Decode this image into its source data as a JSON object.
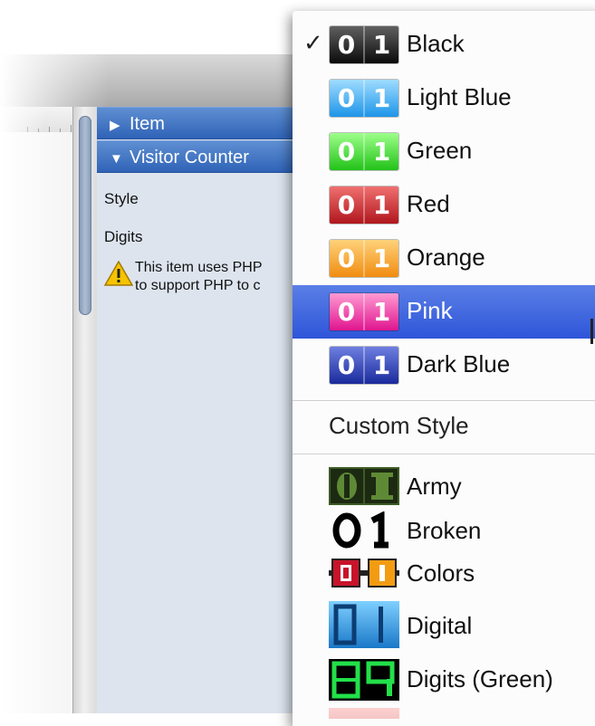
{
  "inspector": {
    "sections": [
      {
        "label": "Item",
        "expanded": false
      },
      {
        "label": "Visitor Counter",
        "expanded": true
      }
    ],
    "labels": {
      "style": "Style",
      "digits": "Digits"
    },
    "warning": "This item uses PHP\nto support PHP to c"
  },
  "menu": {
    "items": [
      {
        "label": "Black",
        "checked": true,
        "selected": false,
        "colors": [
          "#606060",
          "#0a0a0a"
        ]
      },
      {
        "label": "Light Blue",
        "checked": false,
        "selected": false,
        "colors": [
          "#9fdcff",
          "#1d95e8"
        ]
      },
      {
        "label": "Green",
        "checked": false,
        "selected": false,
        "colors": [
          "#9dff8a",
          "#22c218"
        ]
      },
      {
        "label": "Red",
        "checked": false,
        "selected": false,
        "colors": [
          "#f07070",
          "#b0161c"
        ]
      },
      {
        "label": "Orange",
        "checked": false,
        "selected": false,
        "colors": [
          "#ffd27a",
          "#f08c10"
        ]
      },
      {
        "label": "Pink",
        "checked": false,
        "selected": true,
        "colors": [
          "#ff9ad2",
          "#e0158f"
        ]
      },
      {
        "label": "Dark Blue",
        "checked": false,
        "selected": false,
        "colors": [
          "#6e7fe0",
          "#1a2a9c"
        ]
      }
    ],
    "swatch_text": [
      "0",
      "1"
    ],
    "check_glyph": "✓",
    "custom_header": "Custom Style",
    "custom_items": [
      {
        "label": "Army",
        "icon": "army-counter-icon"
      },
      {
        "label": "Broken",
        "icon": "broken-counter-icon"
      },
      {
        "label": "Colors",
        "icon": "colors-counter-icon"
      },
      {
        "label": "Digital",
        "icon": "digital-counter-icon"
      },
      {
        "label": "Digits (Green)",
        "icon": "digits-green-counter-icon"
      }
    ],
    "accent": "#2e55d9"
  }
}
